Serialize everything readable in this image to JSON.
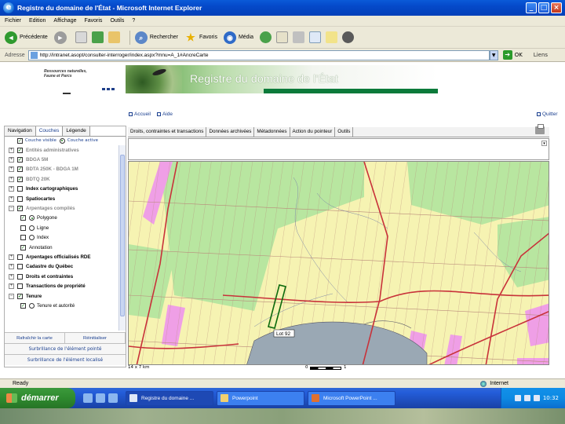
{
  "window": {
    "title": "Registre du domaine de l'État - Microsoft Internet Explorer"
  },
  "menu": [
    "Fichier",
    "Edition",
    "Affichage",
    "Favoris",
    "Outils",
    "?"
  ],
  "toolbar": {
    "back": "Précédente",
    "search": "Rechercher",
    "favorites": "Favoris",
    "media": "Média"
  },
  "address": {
    "label": "Adresse",
    "url": "http://intranet.asopt/consulter-interroger/index.aspx?mnu=A_1#AncreCarte",
    "go": "OK",
    "links": "Liens"
  },
  "header": {
    "logo_text": "Ressources naturelles, Faune et Parcs",
    "banner_title": "Registre du domaine de l'État",
    "link_home": "Accueil",
    "link_help": "Aide",
    "quit": "Quitter"
  },
  "left_tabs": [
    "Navigation",
    "Couches",
    "Légende"
  ],
  "visibility": {
    "visible": "Couche visible",
    "active": "Couche active"
  },
  "layers": [
    {
      "label": "Entités administratives",
      "dim": true
    },
    {
      "label": "BDGA 5M",
      "dim": true
    },
    {
      "label": "BDTA 250K - BDGA 1M",
      "dim": true
    },
    {
      "label": "BDTQ 20K",
      "dim": true
    },
    {
      "label": "Index cartographiques",
      "dim": false
    },
    {
      "label": "Spatiocartes",
      "dim": false
    },
    {
      "label": "Arpentages compilés",
      "dim": true
    },
    {
      "label": "Polygone",
      "dim": false
    },
    {
      "label": "Ligne",
      "dim": false
    },
    {
      "label": "Index",
      "dim": false
    },
    {
      "label": "Annotation",
      "dim": false
    },
    {
      "label": "Arpentages officialisés RDE",
      "dim": false
    },
    {
      "label": "Cadastre du Québec",
      "dim": false
    },
    {
      "label": "Droits et contraintes",
      "dim": false
    },
    {
      "label": "Transactions de propriété",
      "dim": false
    },
    {
      "label": "Tenure",
      "dim": false
    },
    {
      "label": "Tenure et autorité",
      "dim": false
    }
  ],
  "left_buttons": {
    "refresh": "Rafraîchir la carte",
    "reset": "Réinitialiser",
    "sel_point": "Surbrillance de l'élément pointé",
    "sel_located": "Surbrillance de l'élément localisé"
  },
  "main_tabs": [
    "Droits, contraintes et transactions",
    "Données archivées",
    "Métadonnées",
    "Action du pointeur",
    "Outils"
  ],
  "map": {
    "lot_label": "Lot 92",
    "scale_text": "14 x 7 km",
    "scale_start": "0",
    "scale_end": "1"
  },
  "status": {
    "text": "Ready",
    "zone": "Internet"
  },
  "taskbar": {
    "start": "démarrer",
    "tasks": [
      "Registre du domaine ...",
      "Powerpoint",
      "Microsoft PowerPoint ..."
    ],
    "clock": "10:32"
  },
  "colors": {
    "title_bar": "#0549c9",
    "map_yellow": "#f6f3b2",
    "map_green": "#b8e6a0",
    "map_pink": "#ef9fe6",
    "road_red": "#c8323a",
    "water": "#9aa8b4"
  }
}
